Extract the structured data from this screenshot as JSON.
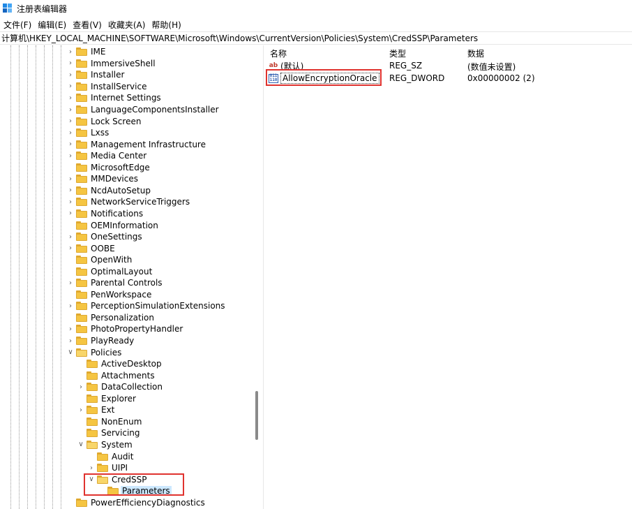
{
  "window": {
    "title": "注册表编辑器"
  },
  "menu": [
    "文件(F)",
    "编辑(E)",
    "查看(V)",
    "收藏夹(A)",
    "帮助(H)"
  ],
  "address": "计算机\\HKEY_LOCAL_MACHINE\\SOFTWARE\\Microsoft\\Windows\\CurrentVersion\\Policies\\System\\CredSSP\\Parameters",
  "tree": [
    {
      "label": "IME",
      "expander": "collapsed",
      "level": 0
    },
    {
      "label": "ImmersiveShell",
      "expander": "collapsed",
      "level": 0
    },
    {
      "label": "Installer",
      "expander": "collapsed",
      "level": 0
    },
    {
      "label": "InstallService",
      "expander": "collapsed",
      "level": 0
    },
    {
      "label": "Internet Settings",
      "expander": "collapsed",
      "level": 0
    },
    {
      "label": "LanguageComponentsInstaller",
      "expander": "collapsed",
      "level": 0
    },
    {
      "label": "Lock Screen",
      "expander": "collapsed",
      "level": 0
    },
    {
      "label": "Lxss",
      "expander": "collapsed",
      "level": 0
    },
    {
      "label": "Management Infrastructure",
      "expander": "collapsed",
      "level": 0
    },
    {
      "label": "Media Center",
      "expander": "collapsed",
      "level": 0
    },
    {
      "label": "MicrosoftEdge",
      "expander": "none",
      "level": 0
    },
    {
      "label": "MMDevices",
      "expander": "collapsed",
      "level": 0
    },
    {
      "label": "NcdAutoSetup",
      "expander": "collapsed",
      "level": 0
    },
    {
      "label": "NetworkServiceTriggers",
      "expander": "collapsed",
      "level": 0
    },
    {
      "label": "Notifications",
      "expander": "collapsed",
      "level": 0
    },
    {
      "label": "OEMInformation",
      "expander": "none",
      "level": 0
    },
    {
      "label": "OneSettings",
      "expander": "collapsed",
      "level": 0
    },
    {
      "label": "OOBE",
      "expander": "collapsed",
      "level": 0
    },
    {
      "label": "OpenWith",
      "expander": "none",
      "level": 0
    },
    {
      "label": "OptimalLayout",
      "expander": "none",
      "level": 0
    },
    {
      "label": "Parental Controls",
      "expander": "collapsed",
      "level": 0
    },
    {
      "label": "PenWorkspace",
      "expander": "none",
      "level": 0
    },
    {
      "label": "PerceptionSimulationExtensions",
      "expander": "collapsed",
      "level": 0
    },
    {
      "label": "Personalization",
      "expander": "none",
      "level": 0
    },
    {
      "label": "PhotoPropertyHandler",
      "expander": "collapsed",
      "level": 0
    },
    {
      "label": "PlayReady",
      "expander": "collapsed",
      "level": 0
    },
    {
      "label": "Policies",
      "expander": "expanded",
      "level": 0
    },
    {
      "label": "ActiveDesktop",
      "expander": "none",
      "level": 1
    },
    {
      "label": "Attachments",
      "expander": "none",
      "level": 1
    },
    {
      "label": "DataCollection",
      "expander": "collapsed",
      "level": 1
    },
    {
      "label": "Explorer",
      "expander": "none",
      "level": 1
    },
    {
      "label": "Ext",
      "expander": "collapsed",
      "level": 1
    },
    {
      "label": "NonEnum",
      "expander": "none",
      "level": 1
    },
    {
      "label": "Servicing",
      "expander": "none",
      "level": 1
    },
    {
      "label": "System",
      "expander": "expanded",
      "level": 1
    },
    {
      "label": "Audit",
      "expander": "none",
      "level": 2
    },
    {
      "label": "UIPI",
      "expander": "collapsed",
      "level": 2
    },
    {
      "label": "CredSSP",
      "expander": "expanded",
      "level": 2
    },
    {
      "label": "Parameters",
      "expander": "none",
      "level": 3,
      "selected": true
    },
    {
      "label": "PowerEfficiencyDiagnostics",
      "expander": "none",
      "level": 0
    }
  ],
  "values_pane": {
    "columns": {
      "name": "名称",
      "type": "类型",
      "data": "数据"
    },
    "rows": [
      {
        "icon": "string-value-icon",
        "name": "(默认)",
        "type": "REG_SZ",
        "data": "(数值未设置)"
      },
      {
        "icon": "dword-value-icon",
        "name": "AllowEncryptionOracle",
        "type": "REG_DWORD",
        "data": "0x00000002 (2)",
        "selected": true
      }
    ]
  },
  "colors": {
    "highlight_box": "#e0332f",
    "selection": "#cce8ff",
    "folder": "#f5c542"
  }
}
